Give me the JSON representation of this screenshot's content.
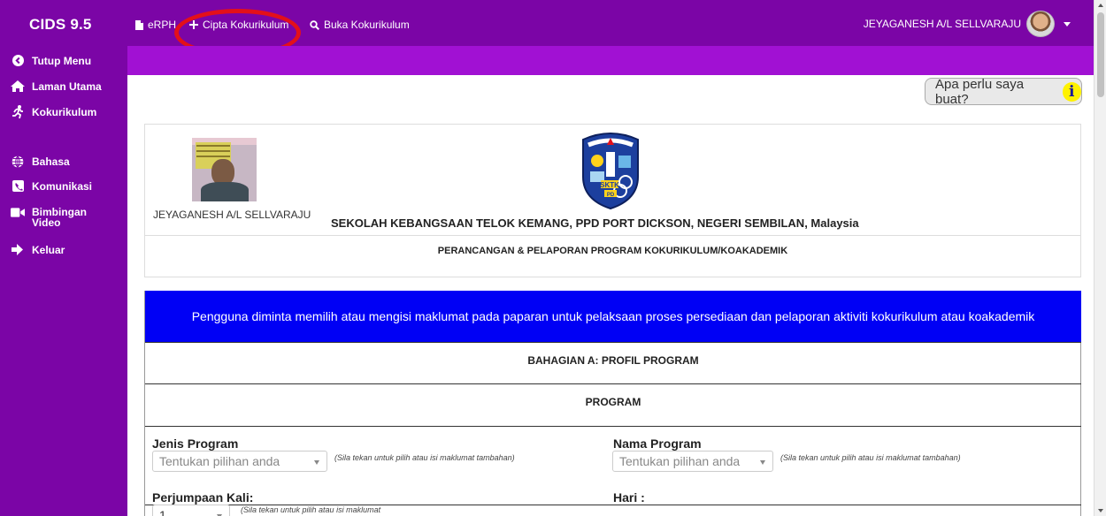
{
  "app": {
    "brand": "CIDS 9.5",
    "nav": [
      {
        "label": "eRPH",
        "icon": "document-icon"
      },
      {
        "label": "Cipta Kokurikulum",
        "icon": "plus-icon"
      },
      {
        "label": "Buka Kokurikulum",
        "icon": "search-icon"
      }
    ],
    "user_name": "JEYAGANESH A/L SELLVARAJU"
  },
  "sidebar": {
    "items": [
      {
        "label": "Tutup Menu",
        "icon": "chevron-left-circle-icon"
      },
      {
        "label": "Laman Utama",
        "icon": "home-icon"
      },
      {
        "label": "Kokurikulum",
        "icon": "running-person-icon"
      },
      {
        "label": "Bahasa",
        "icon": "globe-icon"
      },
      {
        "label": "Komunikasi",
        "icon": "phone-icon"
      },
      {
        "label": "Bimbingan Video",
        "icon": "video-camera-icon"
      },
      {
        "label": "Keluar",
        "icon": "sign-out-icon"
      }
    ]
  },
  "help_button": {
    "label": "Apa perlu saya buat?",
    "icon": "info-icon"
  },
  "header": {
    "teacher_name": "JEYAGANESH A/L SELLVARAJU",
    "school_name": "SEKOLAH KEBANGSAAN TELOK KEMANG, PPD PORT DICKSON, NEGERI SEMBILAN, Malaysia",
    "subtitle": "PERANCANGAN & PELAPORAN PROGRAM KOKURIKULUM/KOAKADEMIK"
  },
  "form": {
    "banner": "Pengguna diminta memilih atau mengisi maklumat pada paparan untuk pelaksaan proses persediaan dan pelaporan aktiviti kokurikulum atau koakademik",
    "section_a": "BAHAGIAN A: PROFIL PROGRAM",
    "program_heading": "PROGRAM",
    "fields": {
      "jenis_program": {
        "label": "Jenis Program",
        "placeholder": "Tentukan pilihan anda",
        "hint": "(Sila tekan untuk pilih atau isi maklumat tambahan)"
      },
      "nama_program": {
        "label": "Nama Program",
        "placeholder": "Tentukan pilihan anda",
        "hint": "(Sila tekan untuk pilih atau isi maklumat tambahan)"
      },
      "perjumpaan_kali": {
        "label": "Perjumpaan Kali:",
        "value": "1",
        "hint": "(Sila tekan untuk pilih atau isi maklumat"
      },
      "hari": {
        "label": "Hari :"
      }
    }
  },
  "colors": {
    "nav": "#7b05a6",
    "strip": "#a111d3",
    "banner": "#0000f5",
    "annotation": "#e3101a"
  }
}
